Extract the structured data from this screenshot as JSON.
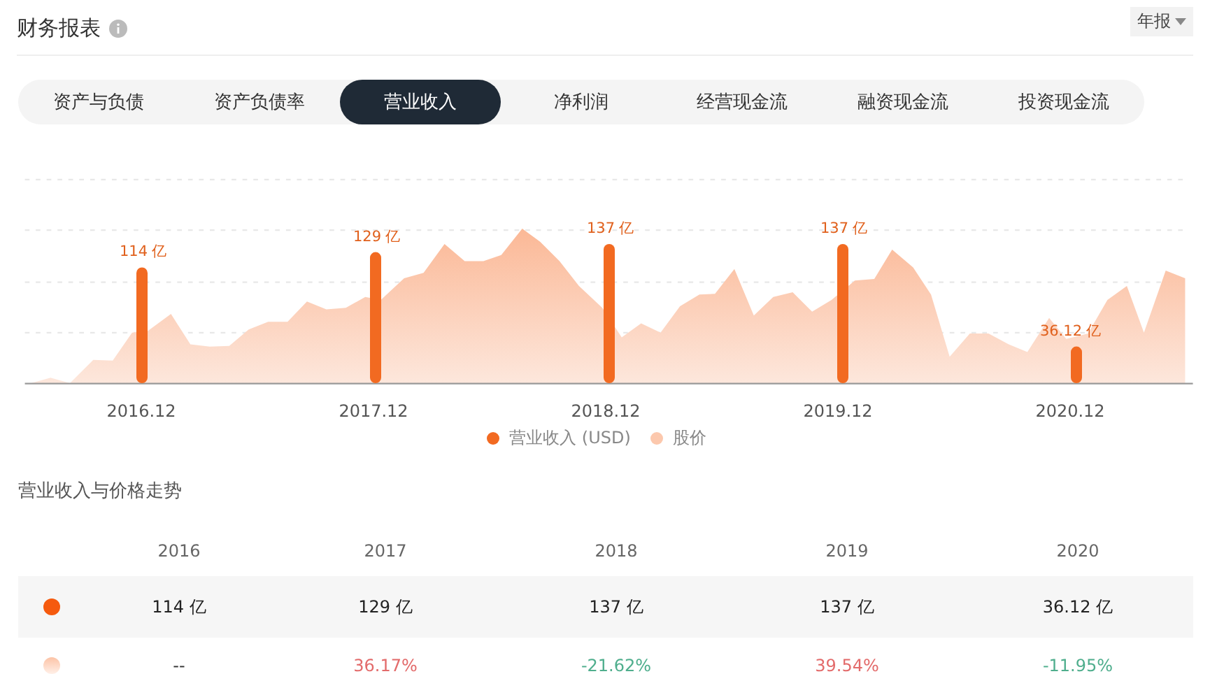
{
  "header": {
    "title": "财务报表",
    "period_select": "年报"
  },
  "tabs": [
    {
      "label": "资产与负债",
      "selected": false
    },
    {
      "label": "资产负债率",
      "selected": false
    },
    {
      "label": "营业收入",
      "selected": true
    },
    {
      "label": "净利润",
      "selected": false
    },
    {
      "label": "经营现金流",
      "selected": false
    },
    {
      "label": "融资现金流",
      "selected": false
    },
    {
      "label": "投资现金流",
      "selected": false
    }
  ],
  "chart": {
    "chart_data": {
      "type": "bar",
      "categories": [
        "2016.12",
        "2017.12",
        "2018.12",
        "2019.12",
        "2020.12"
      ],
      "series": [
        {
          "name": "营业收入 (USD)",
          "color": "#f26a21",
          "values": [
            114,
            129,
            137,
            137,
            36.12
          ]
        }
      ],
      "data_labels": true
    },
    "value_units": [
      "亿",
      "亿",
      "亿",
      "亿",
      "亿"
    ],
    "legend": [
      {
        "label": "股价",
        "color": "#fcc8ad"
      }
    ]
  },
  "trend": {
    "title": "营业收入与价格走势",
    "columns": [
      "2016",
      "2017",
      "2018",
      "2019",
      "2020"
    ],
    "rows": [
      {
        "kind": "revenue",
        "cells": [
          {
            "text": "114 亿"
          },
          {
            "text": "129 亿"
          },
          {
            "text": "137 亿"
          },
          {
            "text": "137 亿"
          },
          {
            "text": "36.12 亿"
          }
        ]
      },
      {
        "kind": "price",
        "cells": [
          {
            "text": "--"
          },
          {
            "text": "36.17%",
            "color": "#e36b6b"
          },
          {
            "text": "-21.62%",
            "color": "#4fae8d"
          },
          {
            "text": "39.54%",
            "color": "#e36b6b"
          },
          {
            "text": "-11.95%",
            "color": "#4fae8d"
          }
        ]
      }
    ]
  }
}
